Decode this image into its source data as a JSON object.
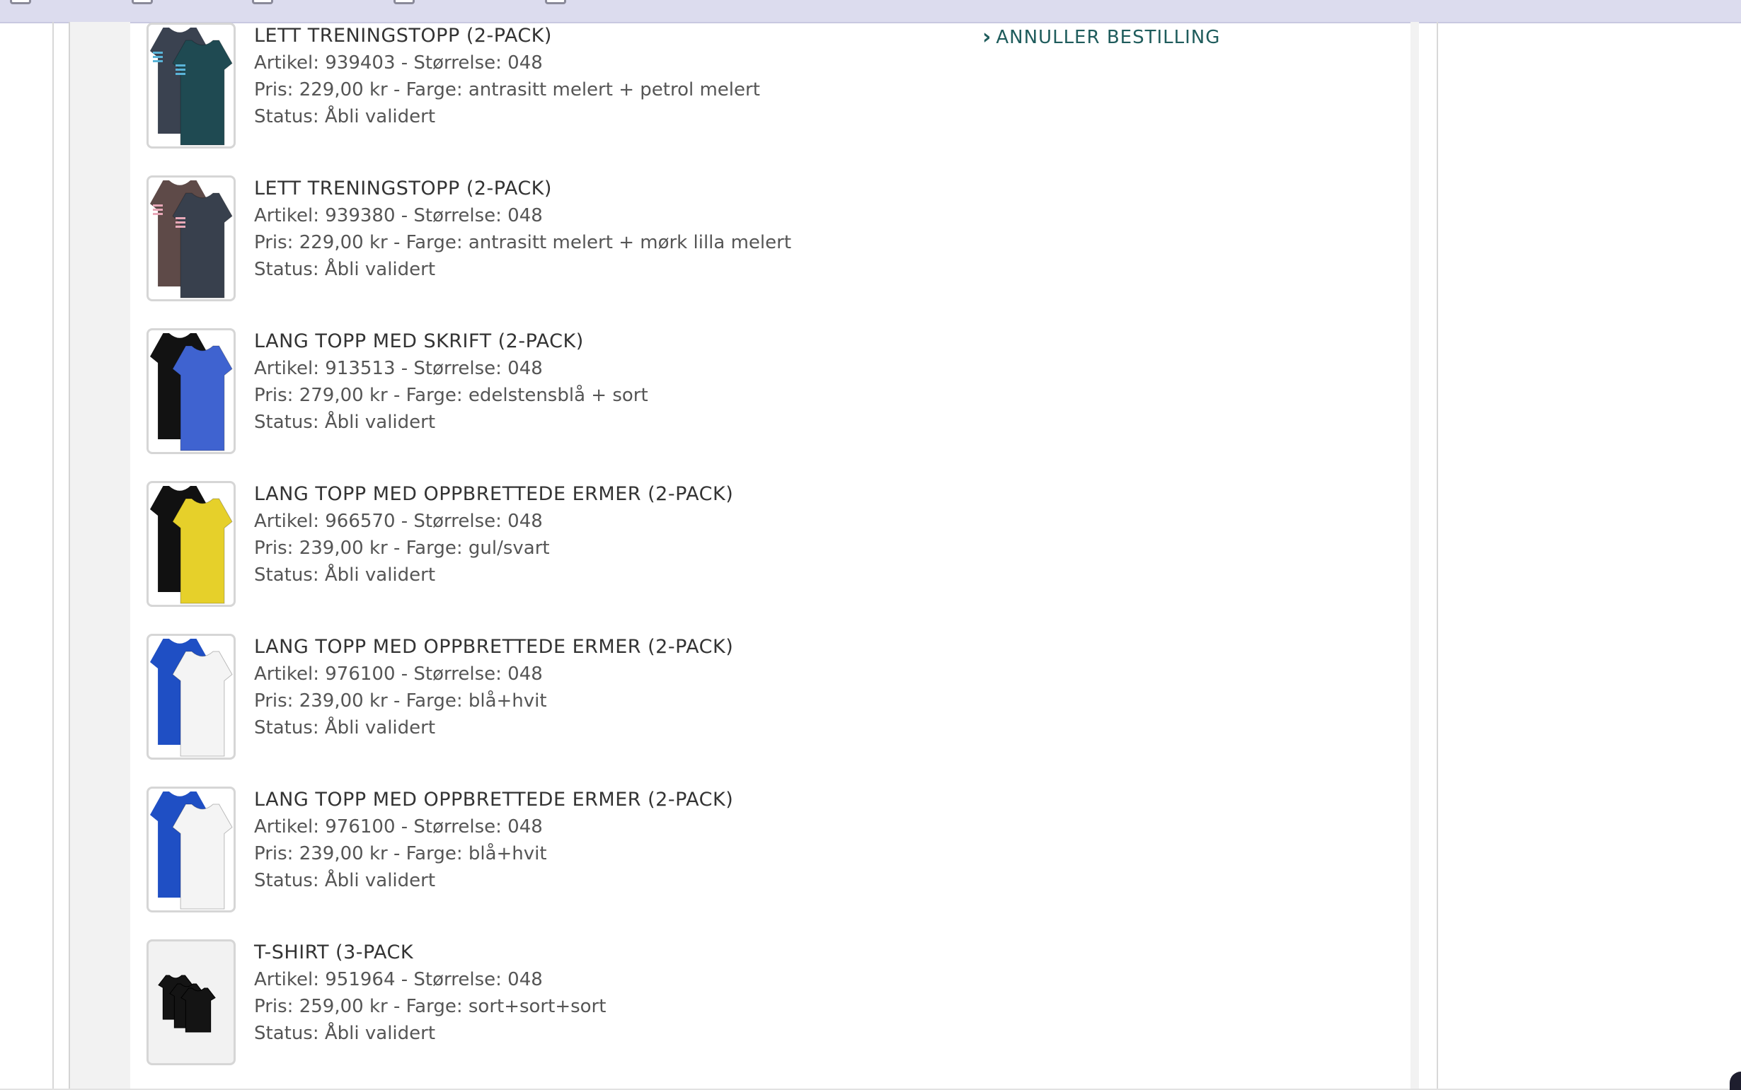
{
  "window": {
    "bookmarks": [
      "",
      "",
      "",
      "",
      ""
    ]
  },
  "order": {
    "cancel_label": "ANNULLER BESTILLING",
    "items": [
      {
        "title": "LETT TRENINGSTOPP (2-PACK)",
        "article_line": "Artikel: 939403 - Størrelse: 048",
        "price_line": "Pris: 229,00 kr - Farge: antrasitt melert + petrol melert",
        "status_line": "Status: Åbli validert",
        "image": "tshirt-2pack-icon",
        "colors": [
          "#3a4250",
          "#1f4a52"
        ],
        "stripe": "#5ab4d8"
      },
      {
        "title": "LETT TRENINGSTOPP (2-PACK)",
        "article_line": "Artikel: 939380 - Størrelse: 048",
        "price_line": "Pris: 229,00 kr - Farge: antrasitt melert + mørk lilla melert",
        "status_line": "Status: Åbli validert",
        "image": "tshirt-2pack-icon",
        "colors": [
          "#5e4a48",
          "#38404d"
        ],
        "stripe": "#e8a8b8"
      },
      {
        "title": "LANG TOPP MED SKRIFT (2-PACK)",
        "article_line": "Artikel: 913513 - Størrelse: 048",
        "price_line": "Pris: 279,00 kr - Farge: edelstensblå + sort",
        "status_line": "Status: Åbli validert",
        "image": "long-top-2pack-icon",
        "colors": [
          "#121212",
          "#3f63d0"
        ],
        "stripe": ""
      },
      {
        "title": "LANG TOPP MED OPPBRETTEDE ERMER (2-PACK)",
        "article_line": "Artikel: 966570 - Størrelse: 048",
        "price_line": "Pris: 239,00 kr - Farge: gul/svart",
        "status_line": "Status: Åbli validert",
        "image": "long-top-2pack-icon",
        "colors": [
          "#111111",
          "#e6d02a"
        ],
        "stripe": ""
      },
      {
        "title": "LANG TOPP MED OPPBRETTEDE ERMER (2-PACK)",
        "article_line": "Artikel: 976100 - Størrelse: 048",
        "price_line": "Pris: 239,00 kr - Farge: blå+hvit",
        "status_line": "Status: Åbli validert",
        "image": "long-top-2pack-icon",
        "colors": [
          "#1f4fc4",
          "#f4f4f4"
        ],
        "stripe": ""
      },
      {
        "title": "LANG TOPP MED OPPBRETTEDE ERMER (2-PACK)",
        "article_line": "Artikel: 976100 - Størrelse: 048",
        "price_line": "Pris: 239,00 kr - Farge: blå+hvit",
        "status_line": "Status: Åbli validert",
        "image": "long-top-2pack-icon",
        "colors": [
          "#1f4fc4",
          "#f4f4f4"
        ],
        "stripe": ""
      },
      {
        "title": "T-SHIRT (3-PACK",
        "article_line": "Artikel: 951964 - Størrelse: 048",
        "price_line": "Pris: 259,00 kr - Farge: sort+sort+sort",
        "status_line": "Status: Åbli validert",
        "image": "tshirt-3pack-icon",
        "colors": [
          "#141414",
          "#141414",
          "#141414"
        ],
        "stripe": ""
      }
    ]
  }
}
